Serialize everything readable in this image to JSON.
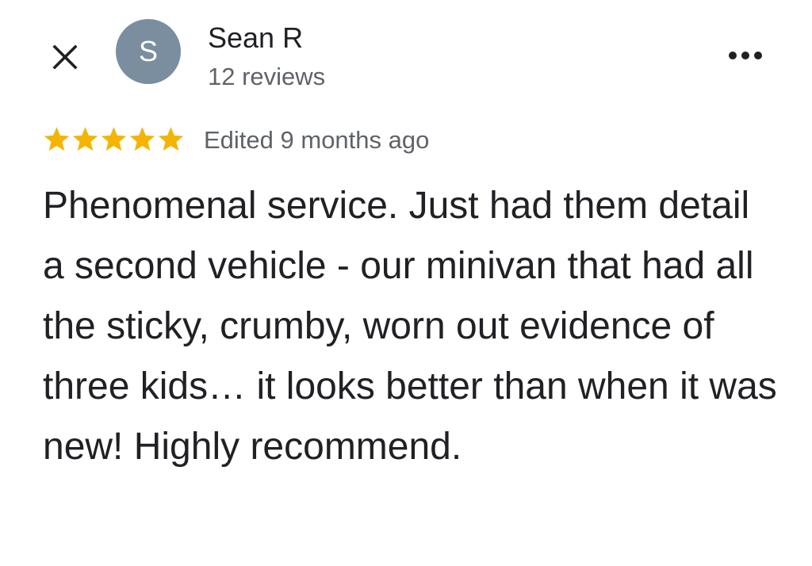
{
  "header": {
    "close_icon": "close-icon",
    "avatar_letter": "S",
    "reviewer_name": "Sean R",
    "review_count": "12 reviews",
    "more_icon": "more-horizontal-icon"
  },
  "rating": {
    "stars": 5,
    "max_stars": 5,
    "edited_time": "Edited 9 months ago"
  },
  "review": {
    "text": "Phenomenal service. Just had them detail a second vehicle - our minivan that had all the sticky, crumby, worn out evidence of three kids… it looks better than when it was new! Highly recommend."
  },
  "colors": {
    "star": "#f4b400",
    "avatar_bg": "#7a8ea0",
    "primary_text": "#202124",
    "secondary_text": "#5f6368"
  }
}
